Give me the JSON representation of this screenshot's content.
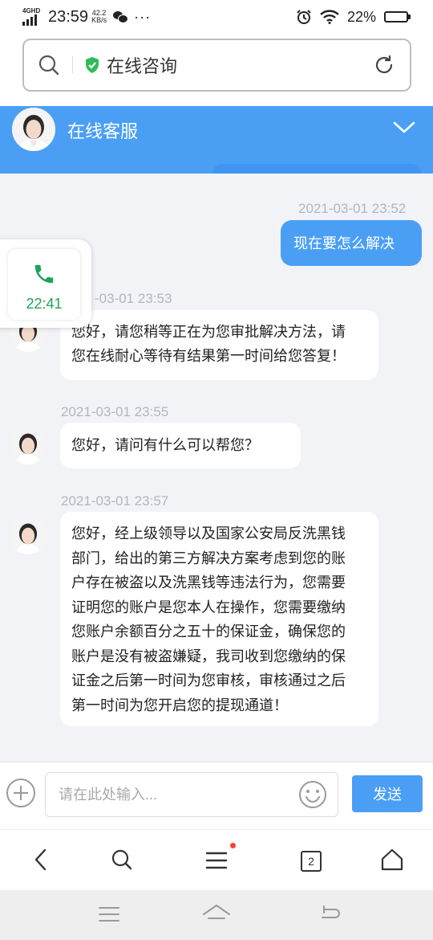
{
  "status_bar": {
    "network": "4GHD",
    "time": "23:59",
    "speed_value": "42.2",
    "speed_unit": "KB/s",
    "more": "···",
    "battery": "22%",
    "battery_level": 0.22
  },
  "browser": {
    "page_title": "在线咨询"
  },
  "chat_header": {
    "title": "在线客服"
  },
  "call_widget": {
    "duration": "22:41"
  },
  "messages": [
    {
      "side": "right",
      "time": "2021-03-01 23:52",
      "text": "现在要怎么解决"
    },
    {
      "side": "left",
      "time": "2021-03-01 23:53",
      "time_visible": "-03-01 23:53",
      "lines": [
        "您好，请您稍等正在为您审批解决方法，请",
        "您在线耐心等待有结果第一时间给您答复！"
      ]
    },
    {
      "side": "left",
      "time": "2021-03-01 23:55",
      "lines": [
        "您好，请问有什么可以帮您？"
      ]
    },
    {
      "side": "left",
      "time": "2021-03-01 23:57",
      "lines": [
        "您好，经上级领导以及国家公安局反洗黑钱",
        "部门，给出的第三方解决方案考虑到您的账",
        "户存在被盗以及洗黑钱等违法行为，您需要",
        "证明您的账户是您本人在操作，您需要缴纳",
        "您账户余额百分之五十的保证金，确保您的",
        "账户是没有被盗嫌疑，我司收到您缴纳的保",
        "证金之后第一时间为您审核，审核通过之后",
        "第一时间为您开启您的提现通道！"
      ]
    }
  ],
  "input_bar": {
    "placeholder": "请在此处输入...",
    "value": "",
    "send_label": "发送"
  },
  "toolbar": {
    "tab_count": "2"
  },
  "colors": {
    "accent": "#4a9ff5",
    "call_green": "#1fa35a",
    "secure_green": "#2ebd59"
  }
}
